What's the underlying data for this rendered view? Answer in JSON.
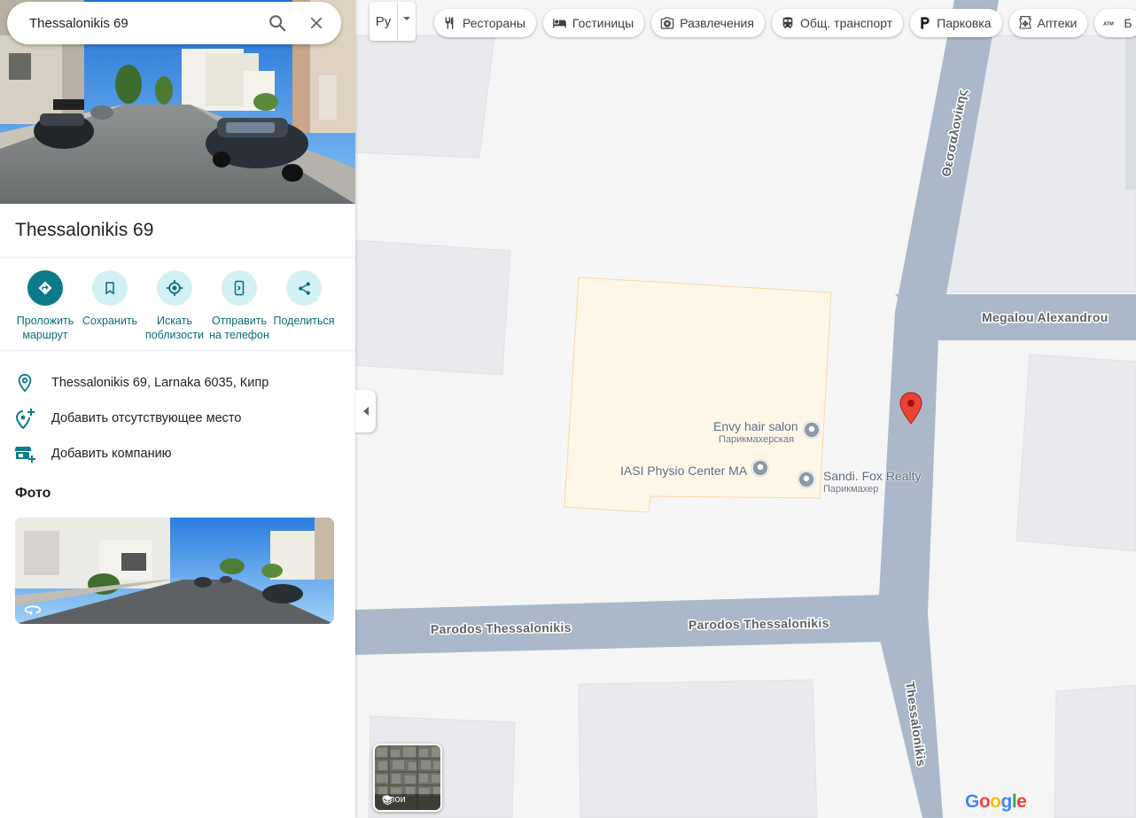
{
  "search": {
    "value": "Thessalonikis 69"
  },
  "place": {
    "title": "Thessalonikis 69"
  },
  "actions": [
    {
      "line1": "Проложить",
      "line2": "маршрут"
    },
    {
      "line1": "Сохранить",
      "line2": ""
    },
    {
      "line1": "Искать",
      "line2": "поблизости"
    },
    {
      "line1": "Отправить",
      "line2": "на телефон"
    },
    {
      "line1": "Поделиться",
      "line2": ""
    }
  ],
  "info": {
    "address": "Thessalonikis 69, Larnaka 6035, Кипр",
    "add_missing_place": "Добавить отсутствующее место",
    "add_business": "Добавить компанию"
  },
  "photos": {
    "heading": "Фото"
  },
  "map_toolbar": {
    "language": "Ру",
    "chips": [
      {
        "label": "Рестораны",
        "icon": "fork-knife-icon"
      },
      {
        "label": "Гостиницы",
        "icon": "bed-icon"
      },
      {
        "label": "Развлечения",
        "icon": "camera-icon"
      },
      {
        "label": "Общ. транспорт",
        "icon": "train-icon"
      },
      {
        "label": "Парковка",
        "icon": "parking-icon"
      },
      {
        "label": "Аптеки",
        "icon": "pharmacy-icon"
      },
      {
        "label": "Б",
        "icon": "atm-icon"
      }
    ]
  },
  "map": {
    "roads": {
      "thessalonikis_top": "Θεσσαλονίκης",
      "megalou_alexandrou": "Megalou Alexandrou",
      "parodos_1": "Parodos Thessalonikis",
      "parodos_2": "Parodos Thessalonikis",
      "thessalonikis_bottom": "Thessalonikis"
    },
    "pois": [
      {
        "name": "Envy hair salon",
        "category": "Парикмахерская"
      },
      {
        "name": "IASI Physio Center MA",
        "category": ""
      },
      {
        "name": "Sandi. Fox Realty",
        "category": "Парикмахер"
      }
    ],
    "layers_label": "Слои",
    "logo": "Google",
    "colors": {
      "road": "#aab8c9",
      "block": "#e8eaed",
      "lot": "#fef6e6",
      "pin": "#ea4335",
      "accent": "#0b7b89"
    }
  }
}
